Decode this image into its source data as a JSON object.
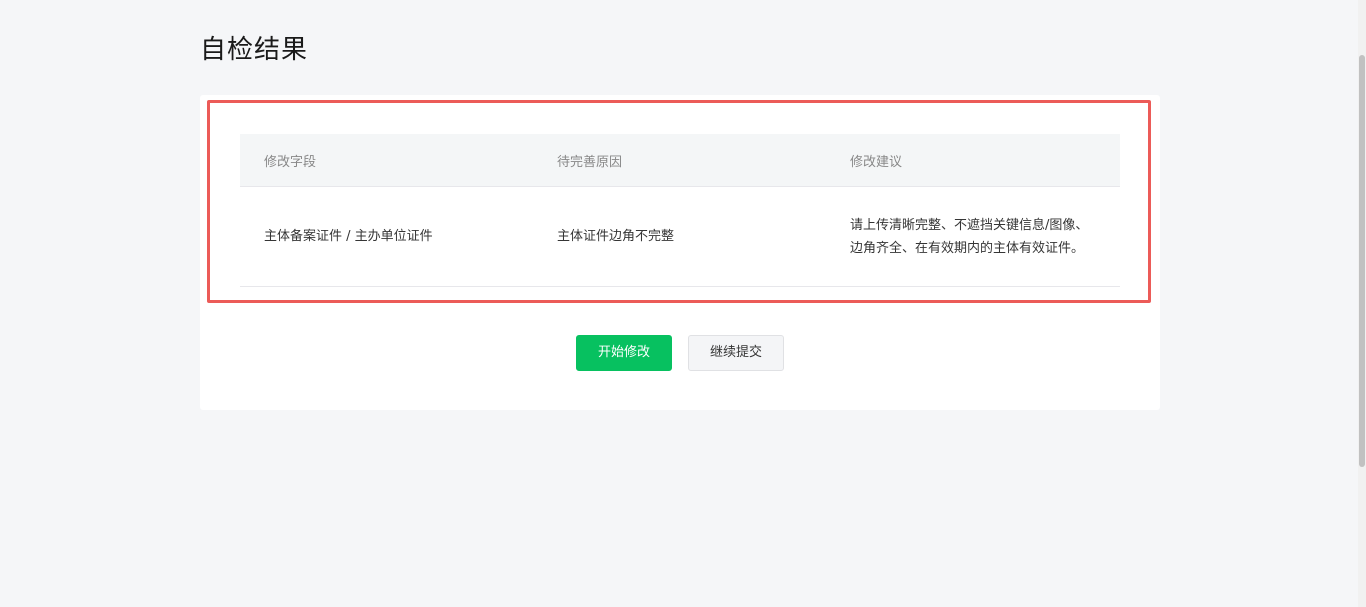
{
  "page": {
    "title": "自检结果"
  },
  "table": {
    "headers": [
      "修改字段",
      "待完善原因",
      "修改建议"
    ],
    "rows": [
      {
        "field": "主体备案证件 / 主办单位证件",
        "reason": "主体证件边角不完整",
        "advice": "请上传清晰完整、不遮挡关键信息/图像、边角齐全、在有效期内的主体有效证件。"
      }
    ]
  },
  "actions": {
    "start_edit_label": "开始修改",
    "continue_submit_label": "继续提交"
  },
  "colors": {
    "primary": "#07c160",
    "highlight": "#ec5b58",
    "background": "#f5f6f8"
  }
}
